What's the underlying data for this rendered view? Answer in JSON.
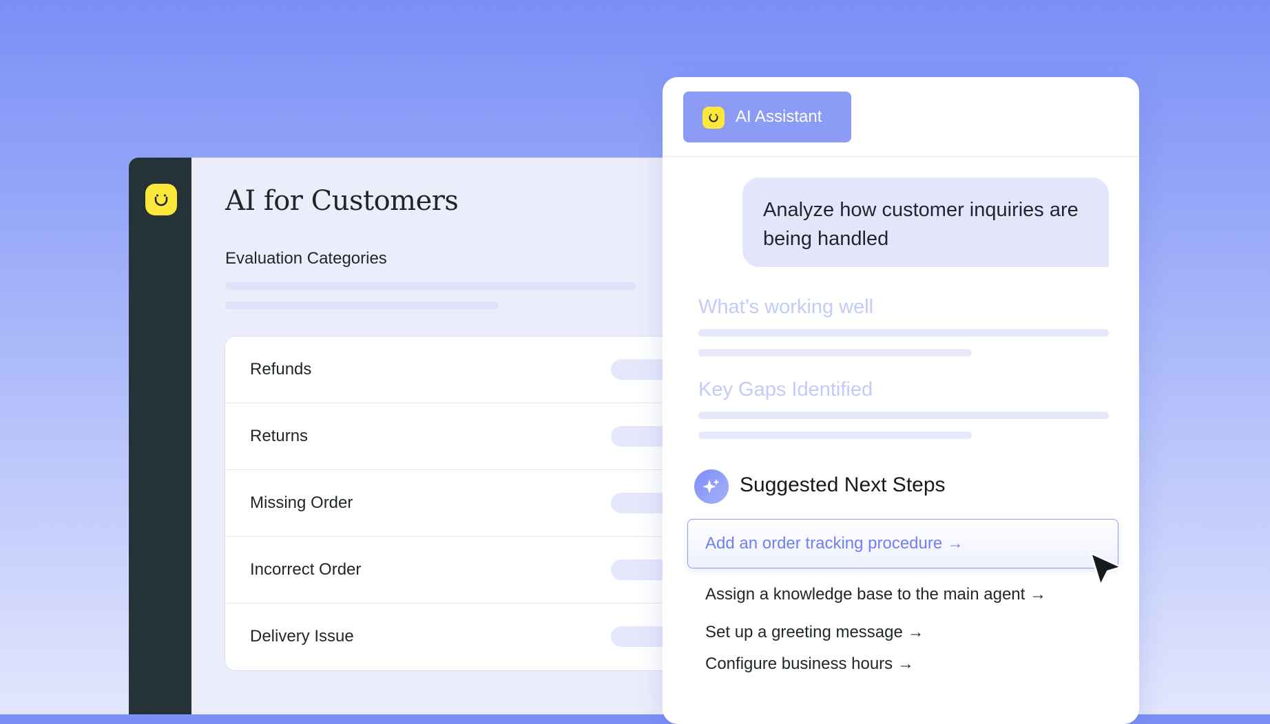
{
  "colors": {
    "background_top": "#7a8ff6",
    "sidebar_rail": "#253238",
    "logo_yellow": "#fbe83a",
    "accent": "#8c9bf5",
    "link_accent": "#6f80ef"
  },
  "app": {
    "logo_icon": "smiley-logo-icon",
    "page_title": "AI for Customers",
    "section_label": "Evaluation Categories",
    "categories": [
      {
        "label": "Refunds"
      },
      {
        "label": "Returns"
      },
      {
        "label": "Missing Order"
      },
      {
        "label": "Incorrect Order"
      },
      {
        "label": "Delivery Issue"
      }
    ]
  },
  "assistant": {
    "tab_label": "AI Assistant",
    "tab_icon": "smiley-logo-icon",
    "user_message": "Analyze how customer inquiries are being handled",
    "working_well_heading": "What’s working well",
    "gaps_heading": "Key Gaps Identified",
    "steps_icon": "sparkle-icon",
    "steps_title": "Suggested Next Steps",
    "steps": [
      {
        "label": "Add an order tracking procedure →"
      },
      {
        "label": "Assign a knowledge base to the main agent →"
      },
      {
        "label": "Set up a greeting message →"
      },
      {
        "label": "Configure business hours →"
      }
    ],
    "pointer_icon": "mouse-pointer-icon"
  }
}
